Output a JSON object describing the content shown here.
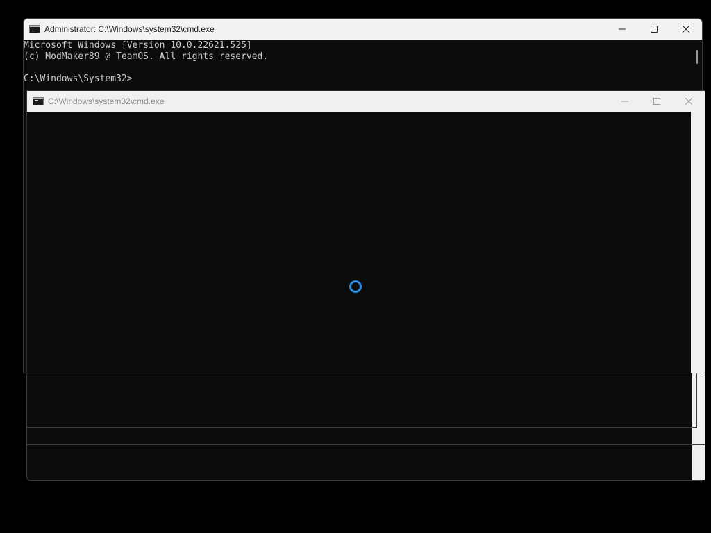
{
  "back_window": {
    "title": "Administrator: C:\\Windows\\system32\\cmd.exe",
    "console_lines": [
      "Microsoft Windows [Version 10.0.22621.525]",
      "(c) ModMaker89 @ TeamOS. All rights reserved.",
      "",
      "C:\\Windows\\System32>"
    ],
    "icon": "cmd-icon",
    "controls": [
      "minimize-icon",
      "maximize-icon",
      "close-icon"
    ]
  },
  "front_window": {
    "title": "C:\\Windows\\system32\\cmd.exe",
    "icon": "cmd-icon",
    "controls": [
      "minimize-icon",
      "maximize-icon",
      "close-icon"
    ],
    "status": "loading"
  },
  "colors": {
    "console_bg": "#0c0c0c",
    "console_text": "#cccccc",
    "titlebar_bg": "#f3f3f3",
    "spinner": "#2b8ee6"
  }
}
